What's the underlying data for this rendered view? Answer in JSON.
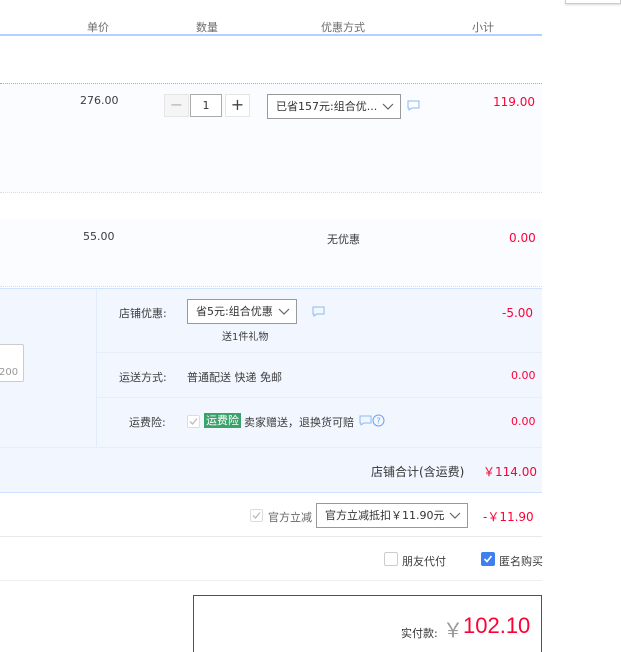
{
  "header": {
    "unit_price": "单价",
    "quantity": "数量",
    "discount": "优惠方式",
    "subtotal": "小计"
  },
  "items": [
    {
      "price": "276.00",
      "quantity": "1",
      "discount_select": "已省157元:组合优...",
      "subtotal": "119.00"
    },
    {
      "price": "55.00",
      "discount_text": "无优惠",
      "subtotal": "0.00"
    }
  ],
  "shop": {
    "promo_label": "店铺优惠:",
    "promo_select": "省5元:组合优惠",
    "promo_gift": "送1件礼物",
    "promo_amount": "-5.00",
    "shipping_label": "运送方式:",
    "shipping_value": "普通配送 快递 免邮",
    "shipping_amount": "0.00",
    "insurance_label": "运费险:",
    "insurance_badge": "运费险",
    "insurance_text": "卖家赠送，退换货可赔",
    "insurance_amount": "0.00",
    "left_input_partial": "200",
    "total_label": "店铺合计(含运费)",
    "total_amount": "￥114.00"
  },
  "official": {
    "checkbox_label": "官方立减",
    "select": "官方立减抵扣￥11.90元",
    "amount": "-￥11.90"
  },
  "options": {
    "friend_pay": "朋友代付",
    "anonymous": "匿名购买"
  },
  "payment": {
    "label": "实付款:",
    "currency": "￥",
    "amount": "102.10"
  },
  "colors": {
    "price_red": "#ff0036",
    "header_line": "#b2d1ff",
    "badge_green": "#3aa36a",
    "checkbox_blue": "#3f7ff0"
  }
}
